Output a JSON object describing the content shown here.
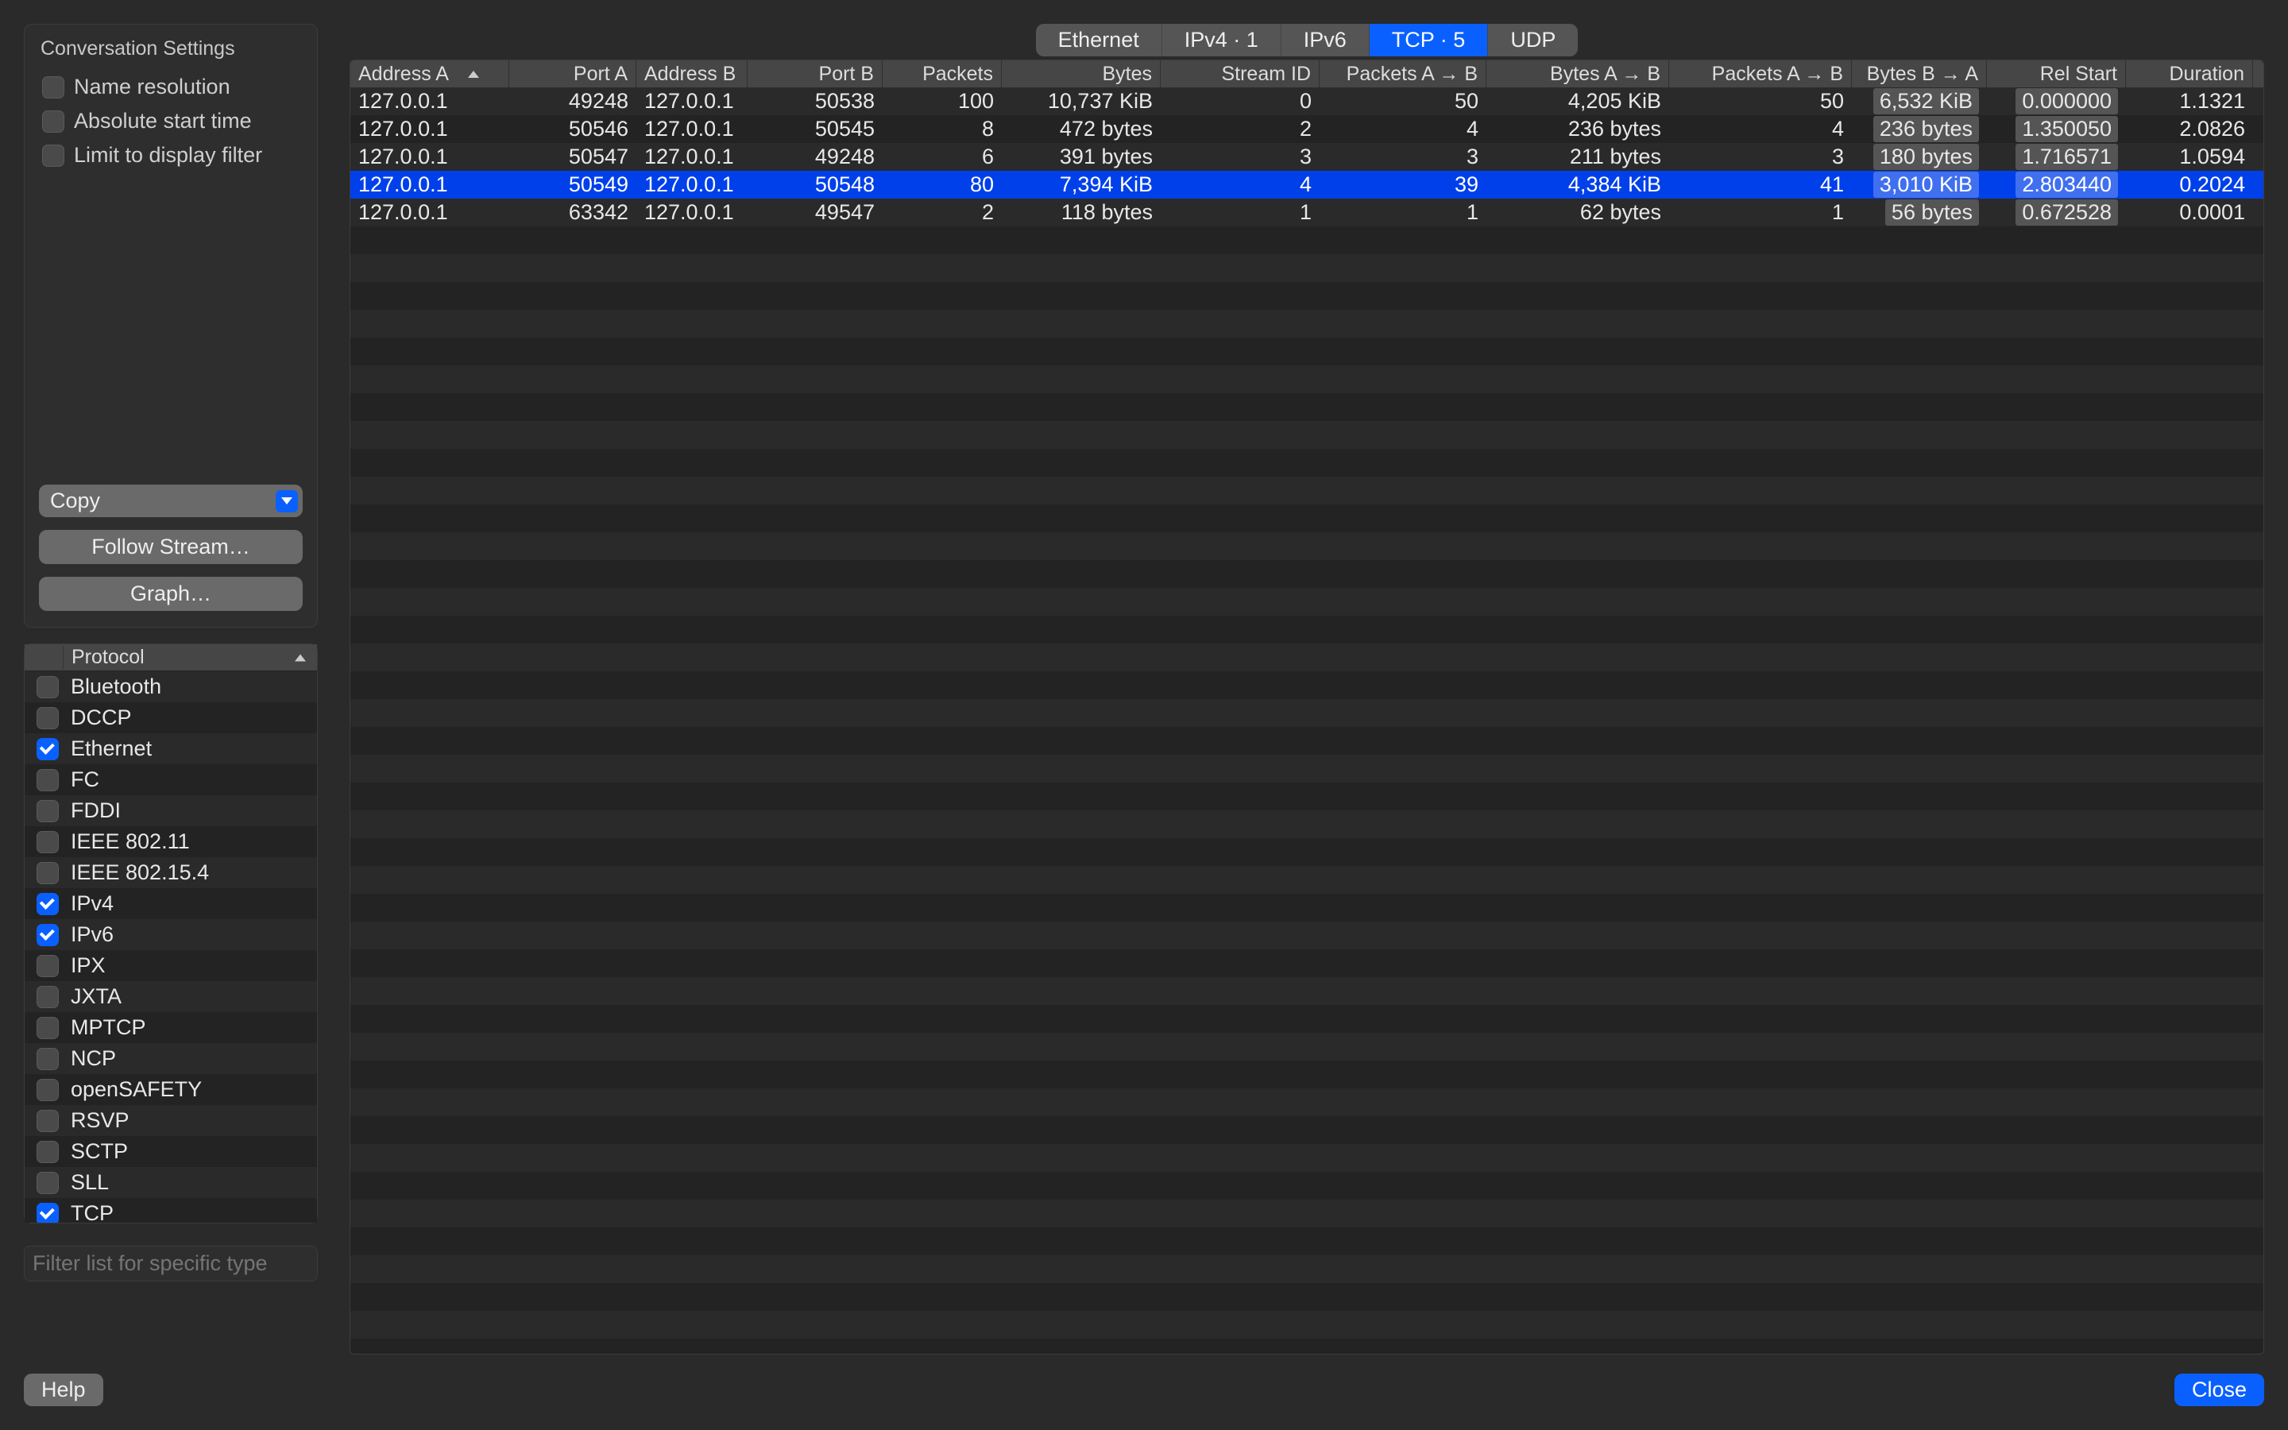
{
  "sidebar": {
    "settings_title": "Conversation Settings",
    "options": [
      {
        "label": "Name resolution",
        "checked": false
      },
      {
        "label": "Absolute start time",
        "checked": false
      },
      {
        "label": "Limit to display filter",
        "checked": false
      }
    ],
    "copy_label": "Copy",
    "follow_label": "Follow Stream…",
    "graph_label": "Graph…",
    "protocol_header": "Protocol",
    "protocols": [
      {
        "label": "Bluetooth",
        "checked": false
      },
      {
        "label": "DCCP",
        "checked": false
      },
      {
        "label": "Ethernet",
        "checked": true
      },
      {
        "label": "FC",
        "checked": false
      },
      {
        "label": "FDDI",
        "checked": false
      },
      {
        "label": "IEEE 802.11",
        "checked": false
      },
      {
        "label": "IEEE 802.15.4",
        "checked": false
      },
      {
        "label": "IPv4",
        "checked": true
      },
      {
        "label": "IPv6",
        "checked": true
      },
      {
        "label": "IPX",
        "checked": false
      },
      {
        "label": "JXTA",
        "checked": false
      },
      {
        "label": "MPTCP",
        "checked": false
      },
      {
        "label": "NCP",
        "checked": false
      },
      {
        "label": "openSAFETY",
        "checked": false
      },
      {
        "label": "RSVP",
        "checked": false
      },
      {
        "label": "SCTP",
        "checked": false
      },
      {
        "label": "SLL",
        "checked": false
      },
      {
        "label": "TCP",
        "checked": true
      }
    ],
    "filter_placeholder": "Filter list for specific type"
  },
  "tabs": [
    {
      "label": "Ethernet",
      "active": false
    },
    {
      "label": "IPv4 · 1",
      "active": false
    },
    {
      "label": "IPv6",
      "active": false
    },
    {
      "label": "TCP · 5",
      "active": true
    },
    {
      "label": "UDP",
      "active": false
    }
  ],
  "table": {
    "columns": [
      "Address A",
      "Port A",
      "Address B",
      "Port B",
      "Packets",
      "Bytes",
      "Stream ID",
      "Packets A → B",
      "Bytes A → B",
      "Packets A → B",
      "Bytes B → A",
      "Rel Start",
      "Duration"
    ],
    "rows": [
      {
        "selected": false,
        "cells": [
          "127.0.0.1",
          "49248",
          "127.0.0.1",
          "50538",
          "100",
          "10,737 KiB",
          "0",
          "50",
          "4,205 KiB",
          "50",
          "6,532 KiB",
          "0.000000",
          "1.1321"
        ]
      },
      {
        "selected": false,
        "cells": [
          "127.0.0.1",
          "50546",
          "127.0.0.1",
          "50545",
          "8",
          "472 bytes",
          "2",
          "4",
          "236 bytes",
          "4",
          "236 bytes",
          "1.350050",
          "2.0826"
        ]
      },
      {
        "selected": false,
        "cells": [
          "127.0.0.1",
          "50547",
          "127.0.0.1",
          "49248",
          "6",
          "391 bytes",
          "3",
          "3",
          "211 bytes",
          "3",
          "180 bytes",
          "1.716571",
          "1.0594"
        ]
      },
      {
        "selected": true,
        "cells": [
          "127.0.0.1",
          "50549",
          "127.0.0.1",
          "50548",
          "80",
          "7,394 KiB",
          "4",
          "39",
          "4,384 KiB",
          "41",
          "3,010 KiB",
          "2.803440",
          "0.2024"
        ]
      },
      {
        "selected": false,
        "cells": [
          "127.0.0.1",
          "63342",
          "127.0.0.1",
          "49547",
          "2",
          "118 bytes",
          "1",
          "1",
          "62 bytes",
          "1",
          "56 bytes",
          "0.672528",
          "0.0001"
        ]
      }
    ],
    "bar_columns": [
      10,
      11
    ]
  },
  "footer": {
    "help_label": "Help",
    "close_label": "Close"
  }
}
